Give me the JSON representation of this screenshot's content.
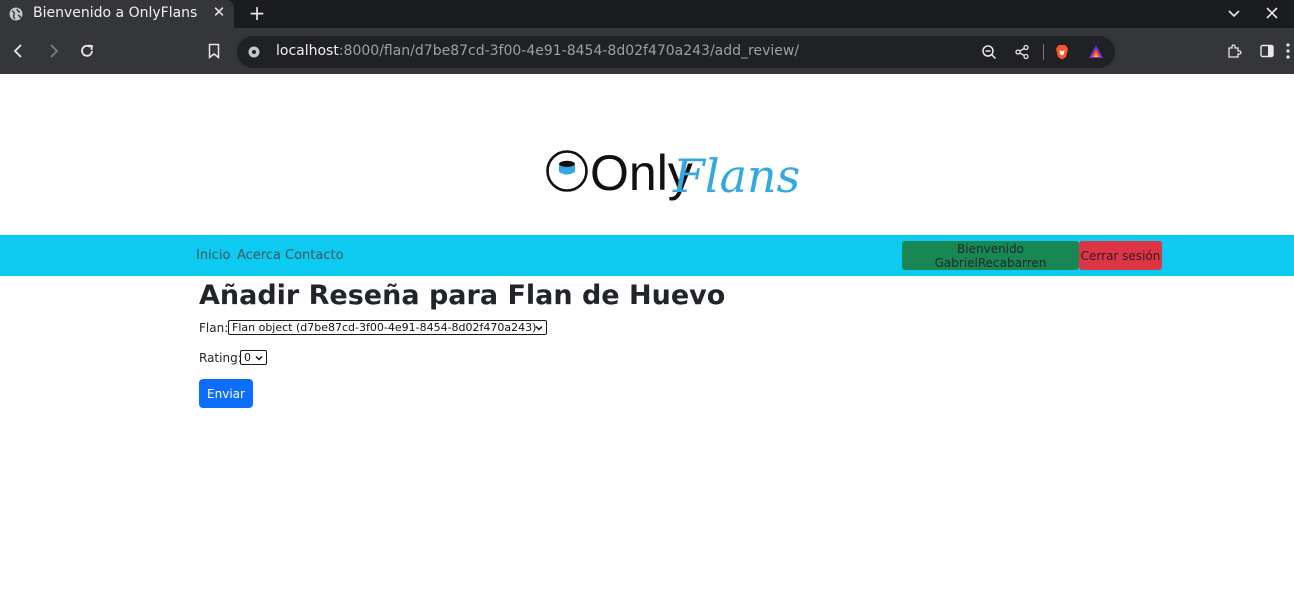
{
  "browser": {
    "tab_title": "Bienvenido a OnlyFlans",
    "url_host": "localhost",
    "url_path": ":8000/flan/d7be87cd-3f00-4e91-8454-8d02f470a243/add_review/"
  },
  "site": {
    "logo_text_only": "Only",
    "logo_text_flans": "Flans",
    "nav": {
      "home": "Inicio",
      "about": "Acerca",
      "contact": "Contacto",
      "welcome": "Bienvenido GabrielRecabarren",
      "logout": "Cerrar sesión"
    }
  },
  "form": {
    "heading": "Añadir Reseña para Flan de Huevo",
    "flan_label": "Flan:",
    "flan_value": "Flan object (d7be87cd-3f00-4e91-8454-8d02f470a243)",
    "rating_label": "Rating:",
    "rating_value": "0",
    "submit": "Enviar"
  },
  "colors": {
    "navbar": "#0dcaf0",
    "welcome_button": "#198754",
    "logout_button": "#dc3545",
    "submit_button": "#0d6efd",
    "logo_accent": "#35a8e0"
  }
}
